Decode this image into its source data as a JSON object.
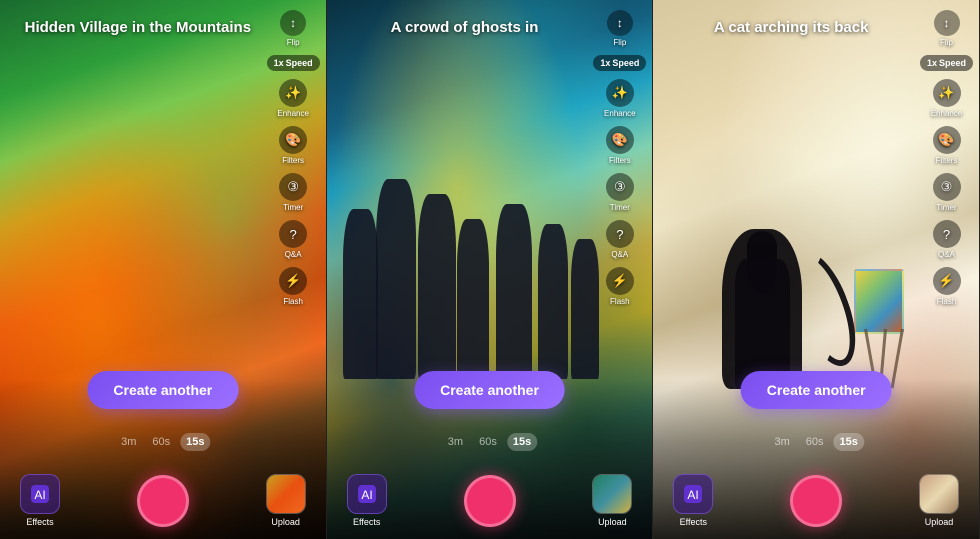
{
  "panels": [
    {
      "id": "panel-1",
      "title": "Hidden Village in the Mountains",
      "create_btn_label": "Create another",
      "durations": [
        "3m",
        "60s",
        "15s"
      ],
      "active_duration": "15s",
      "speed": "1x",
      "controls": [
        "Enhance",
        "Filters",
        "Timer",
        "Q&A",
        "Flash"
      ],
      "effects_label": "Effects",
      "upload_label": "Upload",
      "flip_label": "Flip"
    },
    {
      "id": "panel-2",
      "title": "A crowd of ghosts in",
      "create_btn_label": "Create another",
      "durations": [
        "3m",
        "60s",
        "15s"
      ],
      "active_duration": "15s",
      "speed": "1x",
      "controls": [
        "Enhance",
        "Filters",
        "Timer",
        "Q&A",
        "Flash"
      ],
      "effects_label": "Effects",
      "upload_label": "Upload",
      "flip_label": "Flip"
    },
    {
      "id": "panel-3",
      "title": "A cat arching its back",
      "create_btn_label": "Create another",
      "durations": [
        "3m",
        "60s",
        "15s"
      ],
      "active_duration": "15s",
      "speed": "1x",
      "controls": [
        "Enhance",
        "Filters",
        "Timer",
        "Q&A",
        "Flash"
      ],
      "effects_label": "Effects",
      "upload_label": "Upload",
      "flip_label": "Flip"
    }
  ],
  "icons": {
    "enhance": "✨",
    "filters": "🎨",
    "timer": "⏱",
    "qa": "❓",
    "flash": "⚡",
    "flip": "🔄",
    "ai_effects": "🤖",
    "speed_indicator": "⚡"
  },
  "colors": {
    "create_btn": "#8b5cf6",
    "record_btn": "#f0306a"
  }
}
